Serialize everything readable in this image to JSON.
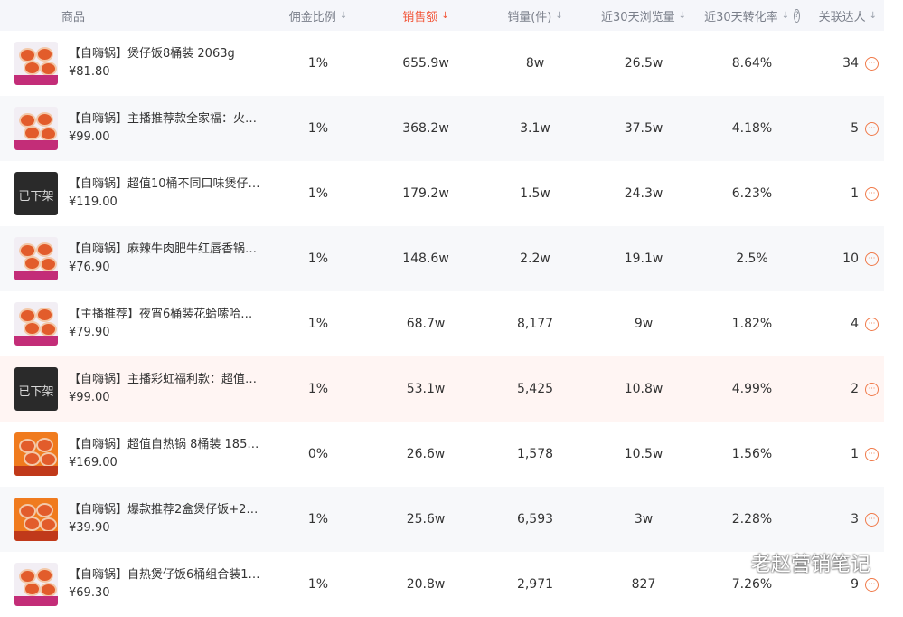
{
  "columns": {
    "product": "商品",
    "commission": "佣金比例",
    "sales_amount": "销售额",
    "sales_volume": "销量(件)",
    "views_30d": "近30天浏览量",
    "conversion_30d": "近30天转化率",
    "linked_influencers": "关联达人"
  },
  "sort_indicator": "↓",
  "help_icon_glyph": "?",
  "more_icon_glyph": "···",
  "off_shelf_label": "已下架",
  "colors": {
    "accent": "#f2573a",
    "header_bg": "#f5f6fa",
    "row_alt": "#f7f8fa",
    "row_highlight": "#fff5f3"
  },
  "rows": [
    {
      "name": "【自嗨锅】煲仔饭8桶装 2063g",
      "price": "¥81.80",
      "commission": "1%",
      "sales_amount": "655.9w",
      "sales_volume": "8w",
      "views": "26.5w",
      "conversion": "8.64%",
      "influencers": "34",
      "thumb": "product-photo"
    },
    {
      "name": "【自嗨锅】主播推荐款全家福：火…",
      "price": "¥99.00",
      "commission": "1%",
      "sales_amount": "368.2w",
      "sales_volume": "3.1w",
      "views": "37.5w",
      "conversion": "4.18%",
      "influencers": "5",
      "thumb": "product-photo"
    },
    {
      "name": "【自嗨锅】超值10桶不同口味煲仔…",
      "price": "¥119.00",
      "commission": "1%",
      "sales_amount": "179.2w",
      "sales_volume": "1.5w",
      "views": "24.3w",
      "conversion": "6.23%",
      "influencers": "1",
      "thumb": "off-shelf"
    },
    {
      "name": "【自嗨锅】麻辣牛肉肥牛红唇香锅…",
      "price": "¥76.90",
      "commission": "1%",
      "sales_amount": "148.6w",
      "sales_volume": "2.2w",
      "views": "19.1w",
      "conversion": "2.5%",
      "influencers": "10",
      "thumb": "product-photo"
    },
    {
      "name": "【主播推荐】夜宵6桶装花蛤嗦哈…",
      "price": "¥79.90",
      "commission": "1%",
      "sales_amount": "68.7w",
      "sales_volume": "8,177",
      "views": "9w",
      "conversion": "1.82%",
      "influencers": "4",
      "thumb": "product-photo"
    },
    {
      "name": "【自嗨锅】主播彩虹福利款：超值…",
      "price": "¥99.00",
      "commission": "1%",
      "sales_amount": "53.1w",
      "sales_volume": "5,425",
      "views": "10.8w",
      "conversion": "4.99%",
      "influencers": "2",
      "thumb": "off-shelf"
    },
    {
      "name": "【自嗨锅】超值自热锅 8桶装 1851g",
      "price": "¥169.00",
      "commission": "0%",
      "sales_amount": "26.6w",
      "sales_volume": "1,578",
      "views": "10.5w",
      "conversion": "1.56%",
      "influencers": "1",
      "thumb": "product-photo-orange"
    },
    {
      "name": "【自嗨锅】爆款推荐2盒煲仔饭+2…",
      "price": "¥39.90",
      "commission": "1%",
      "sales_amount": "25.6w",
      "sales_volume": "6,593",
      "views": "3w",
      "conversion": "2.28%",
      "influencers": "3",
      "thumb": "product-photo-orange"
    },
    {
      "name": "【自嗨锅】自热煲仔饭6桶组合装1…",
      "price": "¥69.30",
      "commission": "1%",
      "sales_amount": "20.8w",
      "sales_volume": "2,971",
      "views": "827",
      "conversion": "7.26%",
      "influencers": "9",
      "thumb": "product-photo"
    }
  ],
  "watermark": "老赵营销笔记"
}
